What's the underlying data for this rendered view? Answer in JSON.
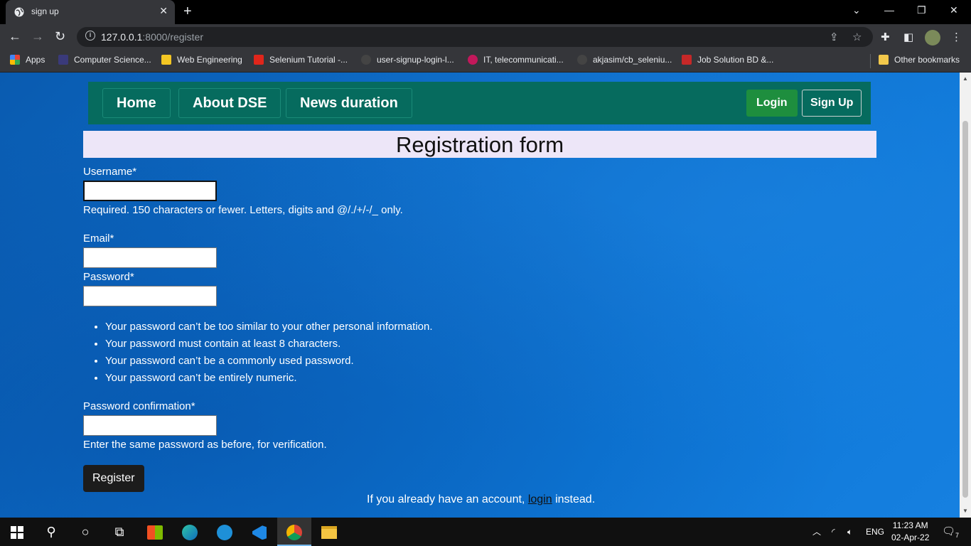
{
  "browser": {
    "tab_title": "sign up",
    "tab_close": "✕",
    "new_tab": "+",
    "url_host": "127.0.0.1",
    "url_rest": ":8000/register",
    "window_controls": [
      "⌄",
      "—",
      "❐",
      "✕"
    ]
  },
  "bookmarks": [
    {
      "label": "Apps",
      "color": "#e84235"
    },
    {
      "label": "Computer Science...",
      "color": "#3a3a7a"
    },
    {
      "label": "Web Engineering",
      "color": "#f3c623"
    },
    {
      "label": "Selenium Tutorial -...",
      "color": "#e0261b"
    },
    {
      "label": "user-signup-login-l...",
      "color": "#444444"
    },
    {
      "label": "IT, telecommunicati...",
      "color": "#c2185b"
    },
    {
      "label": "akjasim/cb_seleniu...",
      "color": "#444444"
    },
    {
      "label": "Job Solution BD &...",
      "color": "#c62828"
    }
  ],
  "other_bookmarks": "Other bookmarks",
  "nav": {
    "links": [
      "Home",
      "About DSE",
      "News duration"
    ],
    "login": "Login",
    "signup": "Sign Up"
  },
  "form": {
    "title": "Registration form",
    "username_label": "Username*",
    "username_value": "",
    "username_help": "Required. 150 characters or fewer. Letters, digits and @/./+/-/_ only.",
    "email_label": "Email*",
    "password_label": "Password*",
    "password_rules": [
      "Your password can’t be too similar to your other personal information.",
      "Your password must contain at least 8 characters.",
      "Your password can’t be a commonly used password.",
      "Your password can’t be entirely numeric."
    ],
    "confirm_label": "Password confirmation*",
    "confirm_help": "Enter the same password as before, for verification.",
    "register_button": "Register",
    "already_prefix": "If you already have an account,",
    "already_link": "login",
    "already_suffix": "instead."
  },
  "taskbar": {
    "language": "ENG",
    "time": "11:23 AM",
    "date": "02-Apr-22",
    "notification_count": "7"
  }
}
